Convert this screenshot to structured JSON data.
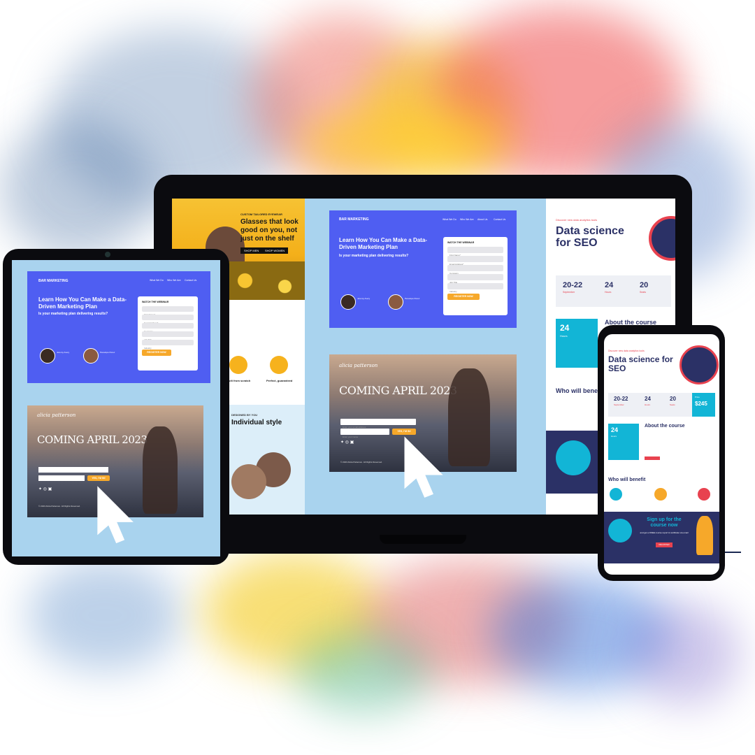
{
  "laptop": {
    "glasses": {
      "kicker": "CUSTOM TAILORED EYEWEAR",
      "headline": "Glasses that look good on you, not just on the shelf",
      "btn_men": "SHOP MEN",
      "btn_women": "SHOP WOMEN",
      "feature_1": "Built from scratch",
      "feature_2": "Perfect, guaranteed",
      "designed_kicker": "DESIGNED BY YOU",
      "designed_title": "Individual style"
    },
    "webinar": {
      "brand": "BAR MARKETING",
      "nav": [
        "What We Do",
        "Who We Are",
        "About Us",
        "Contact Us"
      ],
      "headline": "Learn How You Can Make a Data-Driven Marketing Plan",
      "subheadline": "Is your marketing plan delivering results?",
      "form_title": "WATCH THE WEBINAR",
      "fields": [
        "First Name*",
        "Email Address*",
        "Company",
        "Job Title",
        "Industry"
      ],
      "cta": "REGISTER NOW",
      "speaker_1": "Jeremy Avery",
      "speaker_2": "Penelope Perez"
    },
    "coming": {
      "brand": "alicia patterson",
      "headline": "COMING APRIL 2023",
      "email_placeholder": "Enter your email address",
      "name_placeholder": "Enter your name",
      "cta": "YES, I'M IN!",
      "footer": "© 2023 Alicia Patterson. All Rights Reserved."
    },
    "seo": {
      "kicker": "Discover new data analytics tools",
      "headline": "Data science for SEO",
      "stat_1_value": "20-22",
      "stat_1_label": "September",
      "stat_2_value": "24",
      "stat_2_label": "Hours",
      "stat_3_value": "20",
      "stat_3_label": "Seats",
      "hours_value": "24",
      "hours_label": "Hours",
      "about_title": "About the course",
      "who_title": "Who will benefit"
    }
  },
  "tablet": {
    "brand": "BAR MARKETING",
    "nav": [
      "What We Do",
      "Who We Are",
      "Contact Us"
    ],
    "headline": "Learn How You Can Make a Data-Driven Marketing Plan",
    "subheadline": "Is your marketing plan delivering results?",
    "form_title": "WATCH THE WEBINAR",
    "fields": [
      "First Name*",
      "Email Address*",
      "Company",
      "Job Title",
      "Industry"
    ],
    "cta": "REGISTER NOW",
    "speaker_1": "Jeremy Avery",
    "speaker_2": "Penelope Perez",
    "coming_brand": "alicia patterson",
    "coming_headline": "COMING APRIL 2023",
    "coming_cta": "YES, I'M IN!",
    "coming_footer": "© 2023 Alicia Patterson. All Rights Reserved."
  },
  "phone": {
    "kicker": "Discover new data analytics tools",
    "headline": "Data science for SEO",
    "stat_1_value": "20-22",
    "stat_1_label": "September",
    "stat_2_value": "24",
    "stat_2_label": "Hours",
    "stat_3_value": "20",
    "stat_3_label": "Seats",
    "price_label": "Price",
    "price_value": "$245",
    "hours_value": "24",
    "hours_label": "Hours",
    "about_title": "About the course",
    "who_title": "Who will benefit",
    "signup_title": "Sign up for the course now",
    "signup_sub": "and get a FREE course report & certificate via email",
    "register": "REGISTER"
  },
  "colors": {
    "brand_blue": "#4f5ef2",
    "accent_yellow": "#f6a82a",
    "seo_navy": "#2b3166",
    "seo_teal": "#12b5d6",
    "seo_red": "#e8424f"
  }
}
